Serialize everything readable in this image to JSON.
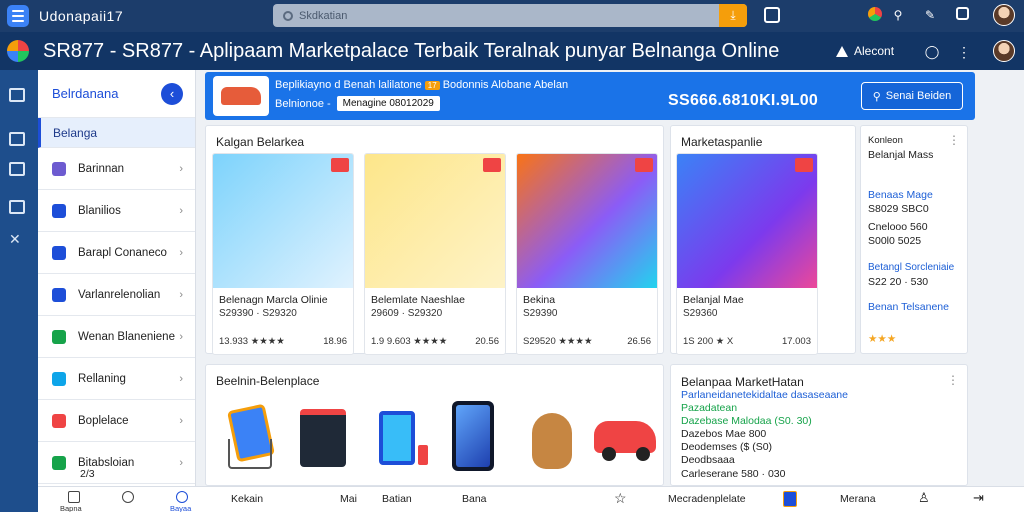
{
  "topbar": {
    "app_title": "Udonapaii17",
    "search_placeholder": "Skdkatian"
  },
  "header": {
    "title": "SR877 - SR877 - Aplipaam Marketpalace Terbaik Teralnak punyar Belnanga Online",
    "alert_label": "Alecont"
  },
  "sidebar": {
    "title": "Belrdanana",
    "active_item": "Belanga",
    "items": [
      {
        "label": "Barinnan",
        "color": "#6d5bd0"
      },
      {
        "label": "Blanilios",
        "color": "#1d4ed8"
      },
      {
        "label": "Barapl Conaneco",
        "color": "#1d4ed8"
      },
      {
        "label": "Varlanrelenolian",
        "color": "#1d4ed8"
      },
      {
        "label": "Wenan Blaneniene",
        "color": "#16a34a"
      },
      {
        "label": "Rellaning",
        "color": "#0ea5e9"
      },
      {
        "label": "Boplelace",
        "color": "#ef4444"
      },
      {
        "label": "Bitabsloian",
        "color": "#16a34a"
      }
    ],
    "footer_count": "2/3"
  },
  "promo": {
    "line1_a": "Beplikiayno d Benah lalilatone",
    "line1_badge": "17",
    "line1_b": "Bodonnis Alobane Abelan",
    "line2_label": "Belnionoe -",
    "line2_pill": "Menagine 08012029",
    "price": "SS666.6810KI.9L00",
    "cta_label": "Senai Beiden"
  },
  "section1": {
    "title": "Kalgan Belarkea",
    "cards": [
      {
        "name": "Belenagn  Marcla Olinie",
        "sub": "S29390 · S29320",
        "stars": "13.933 ★★★★",
        "count": "18.96"
      },
      {
        "name": "Belemlate Naeshlae",
        "sub": "29609 · S29320",
        "stars": "1.9 9.603 ★★★★",
        "count": "20.56"
      },
      {
        "name": "Bekina",
        "sub": "S29390",
        "stars": "S29520 ★★★★",
        "count": "26.56"
      },
      {
        "name": "Belanjal Mae",
        "sub": "S29360",
        "stars": "1S 200 ★ X",
        "count": "17.003"
      }
    ]
  },
  "section1_right": {
    "title": "Marketaspanlie"
  },
  "side_list": {
    "l1": "Konleon",
    "l2": "Belanjal Mass",
    "l3": "Benaas Mage",
    "l4": "S8029 SBC0",
    "l5": "Cnelooo 560",
    "l6": "S00l0 5025",
    "l7": "Betangl Sorcleniaie",
    "l8": "S22 20 · 530",
    "l9": "Benan Telsanene",
    "stars": "★★★"
  },
  "section2": {
    "title": "Beelnin-Belenplace"
  },
  "section2_right": {
    "title": "Belanpaa MarketHatan",
    "l1": "Parlaneidanetekidaltae dasaseaane",
    "l2": "Pazadatean",
    "l3": "Dazebase Malodaa (S0.  30)",
    "l4": "Dazebos Mae 800",
    "l5": "Deodemses ($ (S0)",
    "l6": "Deodbsaaa",
    "l7": "Carleserane 580 · 030"
  },
  "bottom_nav": {
    "home": "Bapna",
    "pay": "Bayaa",
    "i1": "Kekain",
    "i2": "Mai",
    "i3": "Batian",
    "i4": "Bana",
    "i5": "Mecradenplelate",
    "i6": "Merana"
  }
}
